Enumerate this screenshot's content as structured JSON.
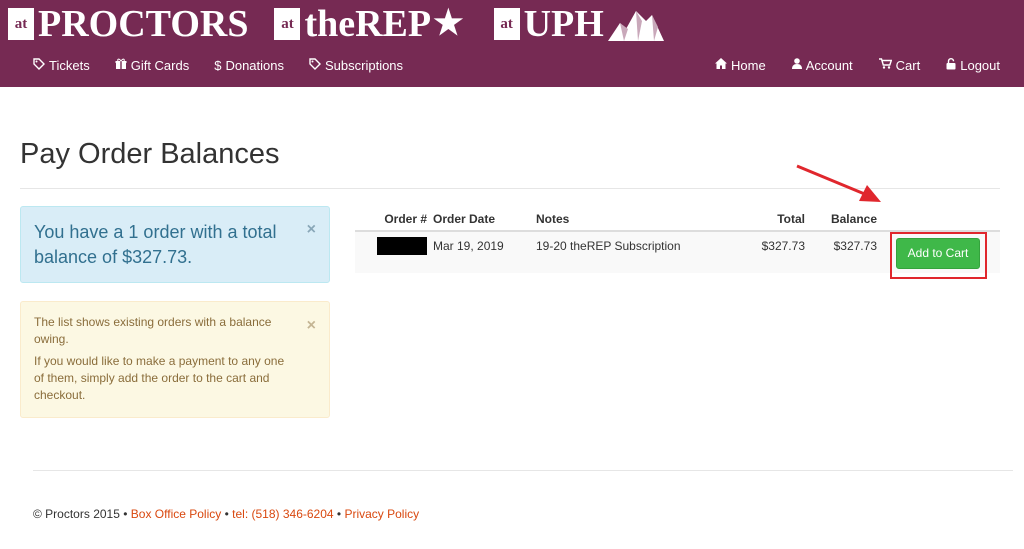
{
  "brand": {
    "logos": [
      {
        "at": "at",
        "name": "PROCTORS"
      },
      {
        "at": "at",
        "name": "theREP"
      },
      {
        "at": "at",
        "name": "UPH"
      }
    ],
    "color": "#762a53"
  },
  "nav": {
    "left": [
      {
        "icon": "tag-icon",
        "label": "Tickets"
      },
      {
        "icon": "gift-icon",
        "label": "Gift Cards"
      },
      {
        "icon": "dollar-icon",
        "label": "Donations"
      },
      {
        "icon": "tag-icon",
        "label": "Subscriptions"
      }
    ],
    "right": [
      {
        "icon": "home-icon",
        "label": "Home"
      },
      {
        "icon": "user-icon",
        "label": "Account"
      },
      {
        "icon": "cart-icon",
        "label": "Cart"
      },
      {
        "icon": "unlock-icon",
        "label": "Logout"
      }
    ]
  },
  "page": {
    "title": "Pay Order Balances"
  },
  "alerts": {
    "info": "You have a 1 order with a total balance of $327.73.",
    "warning_line1": "The list shows existing orders with a balance owing.",
    "warning_line2": "If you would like to make a payment to any one of them, simply add the order to the cart and checkout.",
    "close": "×"
  },
  "table": {
    "headers": {
      "order": "Order #",
      "date": "Order Date",
      "notes": "Notes",
      "total": "Total",
      "balance": "Balance"
    },
    "rows": [
      {
        "order": "",
        "date": "Mar 19, 2019",
        "notes": "19-20 theREP Subscription",
        "total": "$327.73",
        "balance": "$327.73",
        "action": "Add to Cart"
      }
    ]
  },
  "footer": {
    "copyright": "© Proctors 2015",
    "sep": "•",
    "box_office": "Box Office Policy",
    "tel": "tel: (518) 346-6204",
    "privacy": "Privacy Policy"
  }
}
